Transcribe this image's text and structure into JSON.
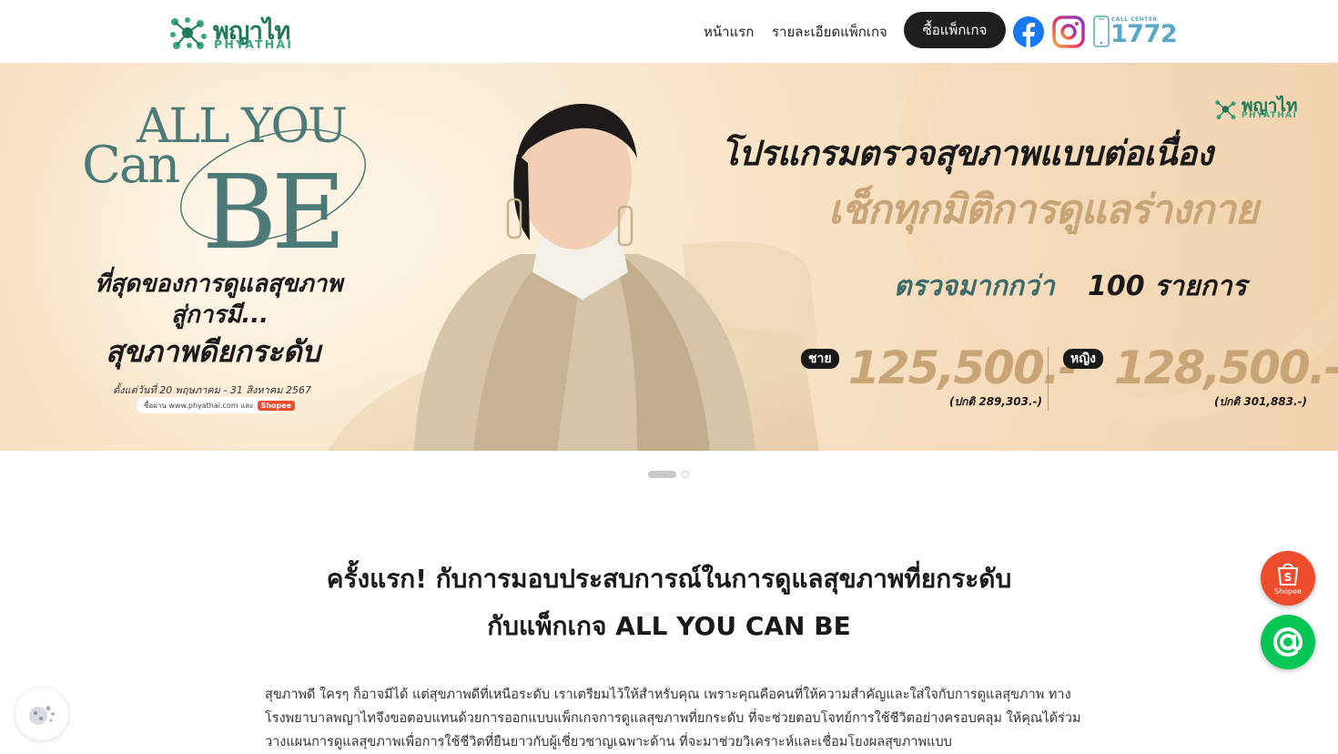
{
  "brand": {
    "logo_thai": "พญาไท",
    "logo_en": "PHYATHAI"
  },
  "nav": {
    "home": "หน้าแรก",
    "package_detail": "รายละเอียดแพ็กเกจ",
    "buy_button": "ซื้อแพ็กเกจ"
  },
  "social": {
    "facebook_icon": "facebook-icon",
    "instagram_icon": "instagram-icon"
  },
  "call_center": {
    "label": "CALL CENTER",
    "number": "1772"
  },
  "hero": {
    "title_all_you": "ALL YOU",
    "title_can": "Can",
    "title_be": "BE",
    "left_line1": "ที่สุดของการดูแลสุขภาพ",
    "left_line2": "สู่การมี...",
    "left_line3": "สุขภาพดียกระดับ",
    "promo_date": "ตั้งแต่วันที่ 20 พฤษภาคม - 31 สิงหาคม 2567",
    "shop_pill_text": "ซื้อผ่าน www.phyathai.com และ",
    "shop_pill_badge": "Shopee",
    "right_title": "โปรแกรมตรวจสุขภาพแบบต่อเนื่อง",
    "right_subtitle": "เช็กทุกมิติการดูแลร่างกาย",
    "check_text": "ตรวจมากกว่า",
    "check_count": "100 รายการ",
    "male_label": "ชาย",
    "male_price": "125,500.-",
    "male_normal": "(ปกติ 289,303.-)",
    "female_label": "หญิง",
    "female_price": "128,500.-",
    "female_normal": "(ปกติ 301,883.-)"
  },
  "carousel": {
    "slides": 2,
    "active": 1
  },
  "content": {
    "headline_line1": "ครั้งแรก! กับการมอบประสบการณ์ในการดูแลสุขภาพที่ยกระดับ",
    "headline_line2": "กับแพ็กเกจ ALL YOU CAN BE",
    "paragraph": "สุขภาพดี ใครๆ ก็อาจมีได้ แต่สุขภาพดีที่เหนือระดับ เราเตรียมไว้ให้สำหรับคุณ เพราะคุณคือคนที่ให้ความสำคัญและใส่ใจกับการดูแลสุขภาพ ทางโรงพยาบาลพญาไทจึงขอตอบแทนด้วยการออกแบบแพ็กเกจการดูแลสุขภาพที่ยกระดับ ที่จะช่วยตอบโจทย์การใช้ชีวิตอย่างครอบคลุม ให้คุณได้ร่วมวางแผนการดูแลสุขภาพเพื่อการใช้ชีวิตที่ยืนยาวกับผู้เชี่ยวชาญเฉพาะด้าน ที่จะมาช่วยวิเคราะห์และเชื่อมโยงผลสุขภาพแบบ"
  },
  "floating": {
    "shopee_label": "Shopee"
  },
  "colors": {
    "brand_green": "#1f7a5c",
    "gold": "#c9a477",
    "shopee": "#ee4d2d",
    "line": "#06c755"
  }
}
